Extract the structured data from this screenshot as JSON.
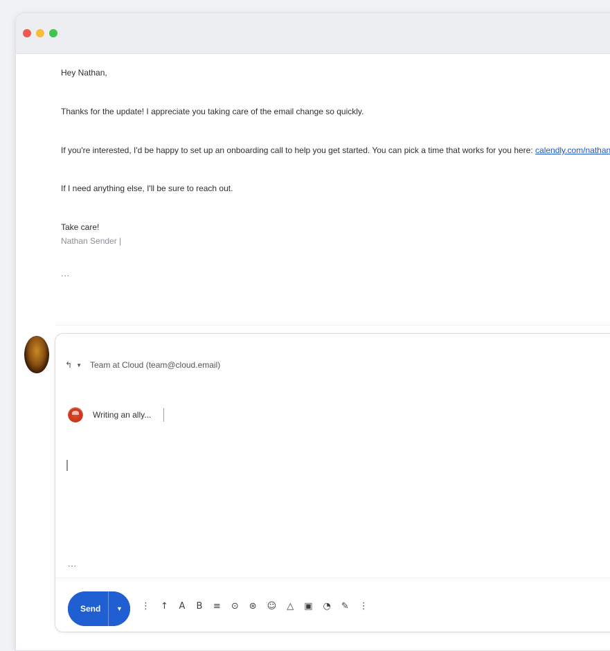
{
  "window": {
    "traffic_lights": [
      "close",
      "minimize",
      "zoom"
    ]
  },
  "thread": {
    "greeting": "Hey Nathan,",
    "line1": "Thanks for the update! I appreciate you taking care of the email change so quickly.",
    "line2": "If you're interested, I'd be happy to set up an onboarding call to help you get started. You can pick a time that works for you here:",
    "link": "calendly.com/nathan",
    "line3": "If I need anything else, I'll be sure to reach out.",
    "closing": "Take care!",
    "signature": "Nathan Sender |",
    "more": "..."
  },
  "compose": {
    "recipient": "Team at Cloud (team@cloud.email)",
    "ai_status": "Writing an ally...",
    "ellipsis": "...",
    "send_label": "Send",
    "send_options_glyph": "▼",
    "tools": [
      {
        "name": "insert-image-icon",
        "glyph": "⋮"
      },
      {
        "name": "text-size-icon",
        "glyph": "↑"
      },
      {
        "name": "underline-icon",
        "glyph": "A"
      },
      {
        "name": "bold-icon",
        "glyph": "B"
      },
      {
        "name": "align-icon",
        "glyph": "≡"
      },
      {
        "name": "attach-icon",
        "glyph": "⊙"
      },
      {
        "name": "link-icon",
        "glyph": "⊛"
      },
      {
        "name": "emoji-icon",
        "glyph": "☺"
      },
      {
        "name": "drive-icon",
        "glyph": "△"
      },
      {
        "name": "photo-icon",
        "glyph": "▣"
      },
      {
        "name": "lock-icon",
        "glyph": "◔"
      },
      {
        "name": "signature-icon",
        "glyph": "✎"
      },
      {
        "name": "more-options-icon",
        "glyph": "⋮"
      }
    ]
  }
}
